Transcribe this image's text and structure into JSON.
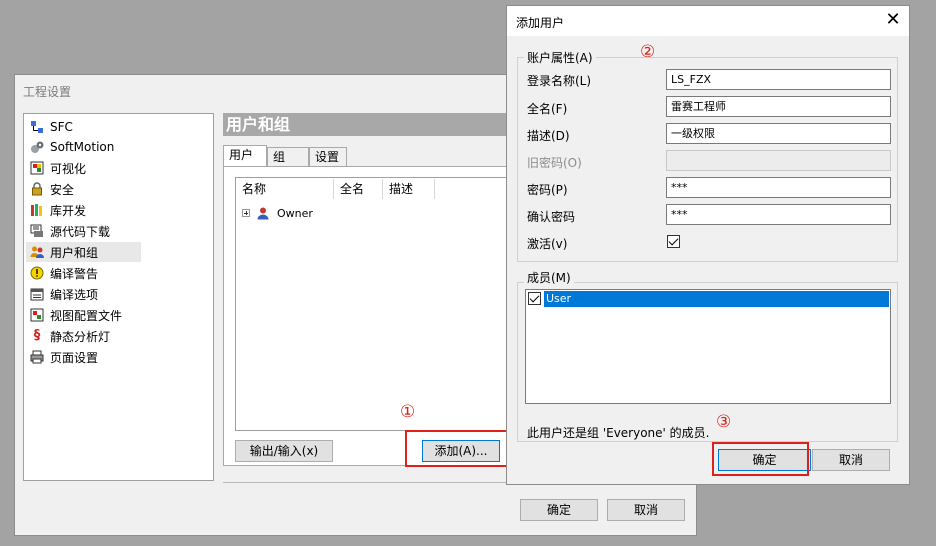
{
  "project_window": {
    "title": "工程设置",
    "nav_items": [
      {
        "label": "SFC",
        "icon": "sfc-icon"
      },
      {
        "label": "SoftMotion",
        "icon": "softmotion-icon"
      },
      {
        "label": "可视化",
        "icon": "visualization-icon"
      },
      {
        "label": "安全",
        "icon": "lock-icon"
      },
      {
        "label": "库开发",
        "icon": "library-icon"
      },
      {
        "label": "源代码下载",
        "icon": "source-download-icon"
      },
      {
        "label": "用户和组",
        "icon": "users-icon"
      },
      {
        "label": "编译警告",
        "icon": "warning-icon"
      },
      {
        "label": "编译选项",
        "icon": "compile-options-icon"
      },
      {
        "label": "视图配置文件",
        "icon": "view-profile-icon"
      },
      {
        "label": "静态分析灯",
        "icon": "static-analysis-icon"
      },
      {
        "label": "页面设置",
        "icon": "printer-icon"
      }
    ],
    "selected_nav": "用户和组",
    "section_title": "用户和组",
    "tabs": [
      "用户",
      "组",
      "设置"
    ],
    "columns": [
      "名称",
      "全名",
      "描述"
    ],
    "users": [
      {
        "name": "Owner"
      }
    ],
    "export_import_label": "输出/输入(x)",
    "add_label": "添加(A)...",
    "ok_label": "确定",
    "cancel_label": "取消"
  },
  "add_user_dialog": {
    "title": "添加用户",
    "close_glyph": "✕",
    "account_group_title": "账户属性(A)",
    "fields": {
      "login_name": {
        "label": "登录名称(L)",
        "value": "LS_FZX"
      },
      "full_name": {
        "label": "全名(F)",
        "value": "雷赛工程师"
      },
      "description": {
        "label": "描述(D)",
        "value": "一级权限"
      },
      "old_password": {
        "label": "旧密码(O)",
        "value": ""
      },
      "password": {
        "label": "密码(P)",
        "value": "***"
      },
      "confirm_password": {
        "label": "确认密码",
        "value": "***"
      }
    },
    "activate_label": "激活(v)",
    "members_group_title": "成员(M)",
    "members": [
      {
        "name": "User",
        "checked": true
      }
    ],
    "everyone_note": "此用户还是组 'Everyone' 的成员.",
    "ok_label": "确定",
    "cancel_label": "取消"
  },
  "annotations": {
    "marker_1": "①",
    "marker_2": "②",
    "marker_3": "③",
    "color": "#e0201b"
  }
}
